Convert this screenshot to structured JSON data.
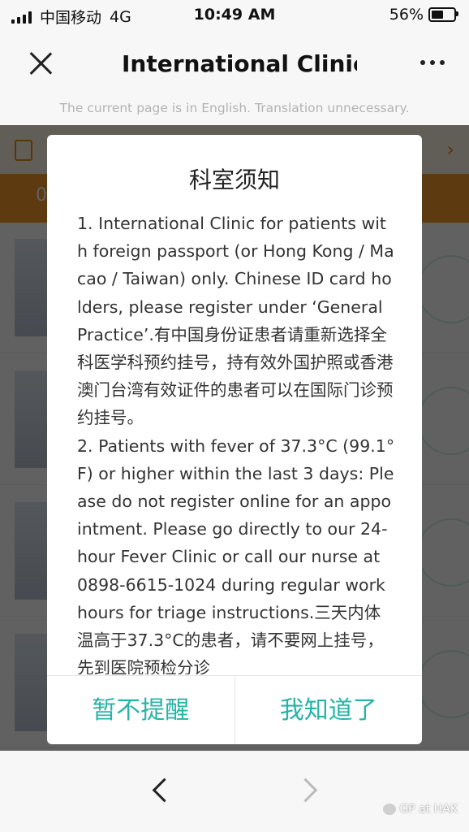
{
  "status_bar": {
    "carrier": "中国移动",
    "network": "4G",
    "time": "10:49 AM",
    "battery": "56%",
    "battery_level": 0.56
  },
  "header": {
    "title": "International Clinic-"
  },
  "translation_note": "The current page is in English. Translation unnecessary.",
  "background": {
    "band_text": "0"
  },
  "modal": {
    "title": "科室须知",
    "paragraphs": [
      "1. International Clinic for patients with foreign passport (or Hong Kong / Macao / Taiwan) only. Chinese ID card holders, please register under ‘General Practice’.有中国身份证患者请重新选择全科医学科预约挂号，持有效外国护照或香港澳门台湾有效证件的患者可以在国际门诊预约挂号。",
      "2. Patients with fever of 37.3°C (99.1°F) or higher within the last 3 days: Please do not register online for an appointment. Please go directly to our 24-hour Fever Clinic or call our nurse at 0898-6615-1024 during regular work hours for triage instructions.三天内体温高于37.3°C的患者，请不要网上挂号，先到医院预检分诊"
    ],
    "btn_dismiss": "暂不提醒",
    "btn_confirm": "我知道了"
  },
  "watermark": "GP at HAK",
  "icons": [
    "close-icon",
    "more-icon",
    "notice-icon",
    "back-arrow-icon",
    "forward-arrow-icon"
  ],
  "colors": {
    "accent": "#27b4a6",
    "orange": "#f39a2c"
  }
}
